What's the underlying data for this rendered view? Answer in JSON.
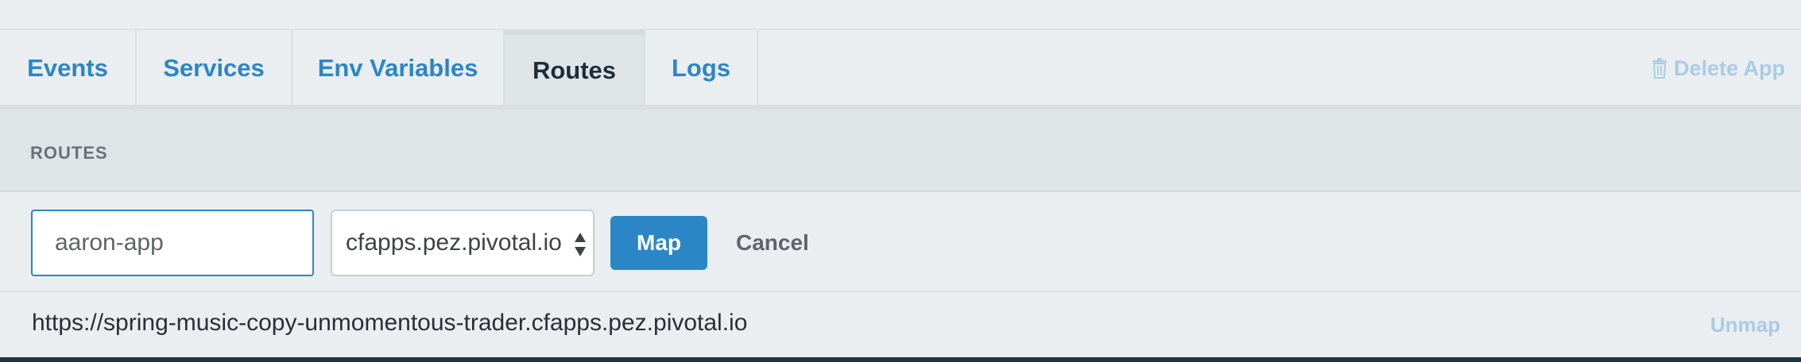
{
  "tabs": [
    {
      "label": "Events",
      "active": false
    },
    {
      "label": "Services",
      "active": false
    },
    {
      "label": "Env Variables",
      "active": false
    },
    {
      "label": "Routes",
      "active": true
    },
    {
      "label": "Logs",
      "active": false
    }
  ],
  "header_actions": {
    "delete_app_label": "Delete App",
    "delete_icon": "trash-icon"
  },
  "routes_section": {
    "title": "ROUTES",
    "form": {
      "host_value": "aaron-app",
      "domain_selected": "cfapps.pez.pivotal.io",
      "map_label": "Map",
      "cancel_label": "Cancel"
    },
    "routes": [
      {
        "url": "https://spring-music-copy-unmomentous-trader.cfapps.pez.pivotal.io",
        "unmap_label": "Unmap"
      }
    ]
  },
  "colors": {
    "accent": "#2b86c6",
    "muted_link": "#a9cbe6",
    "background": "#eaeef0"
  }
}
